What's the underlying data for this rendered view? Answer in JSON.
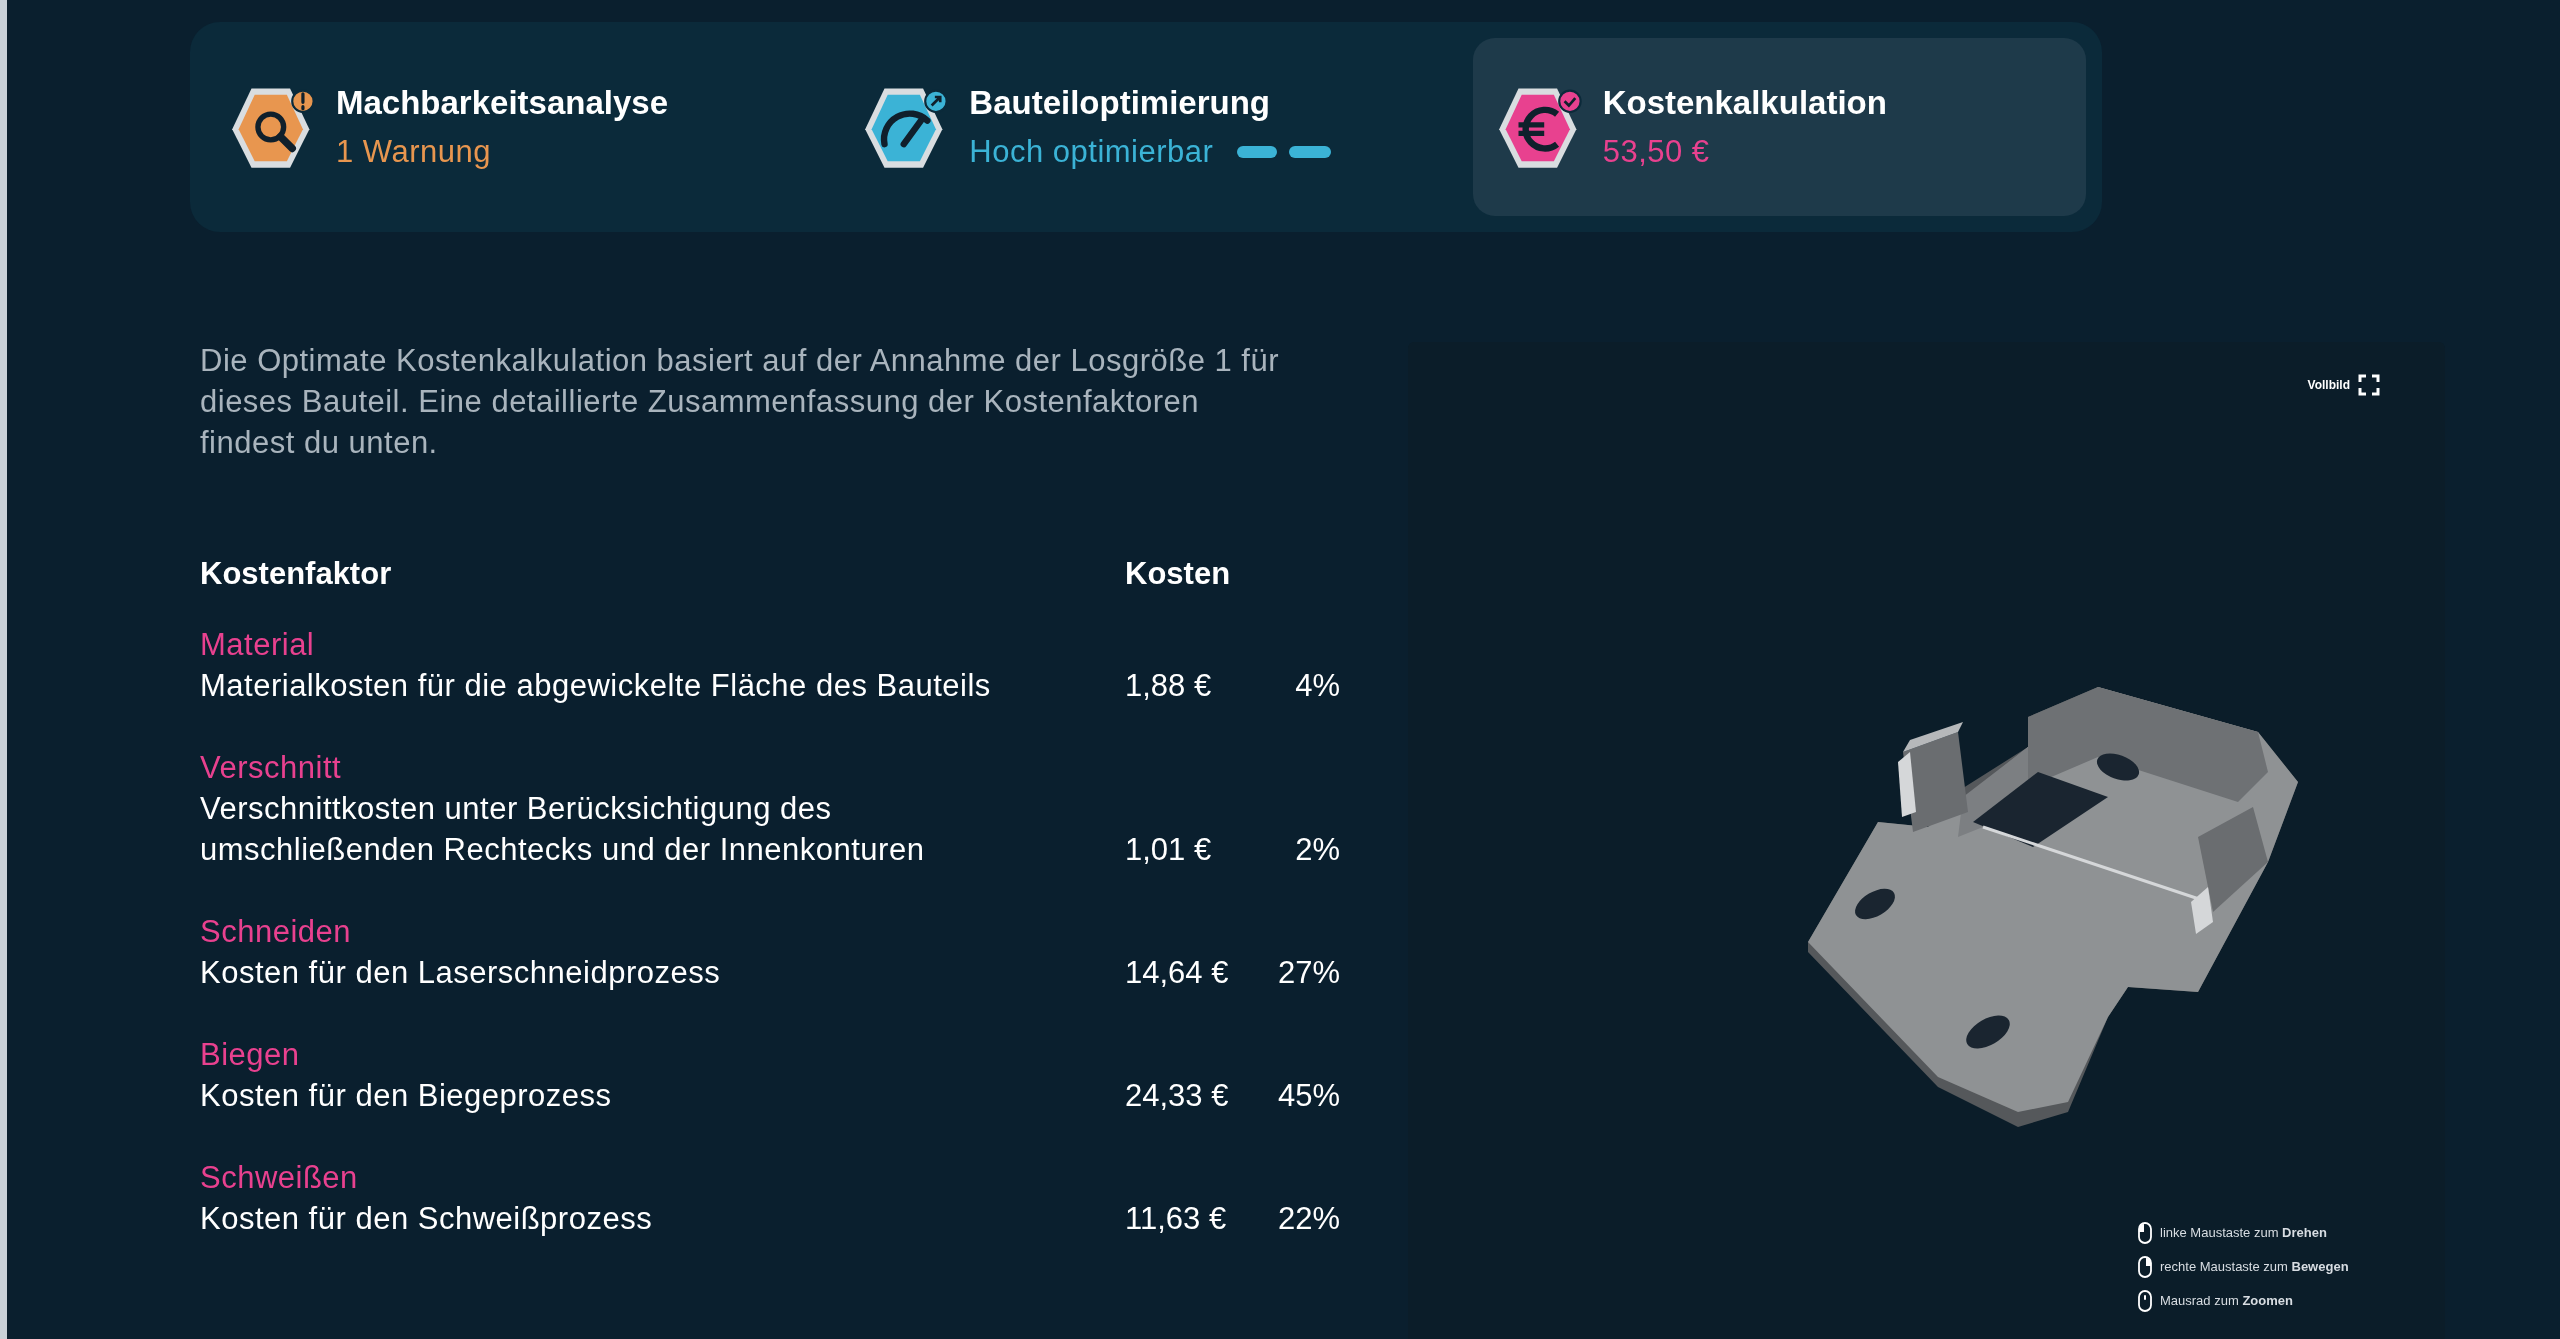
{
  "tabs": [
    {
      "kind": "feasibility",
      "title": "Machbarkeitsanalyse",
      "subtitle": "1 Warnung",
      "color": "#e8964f",
      "selected": false
    },
    {
      "kind": "optimization",
      "title": "Bauteiloptimierung",
      "subtitle": "Hoch optimierbar",
      "color": "#3bb3d6",
      "selected": false
    },
    {
      "kind": "cost",
      "title": "Kostenkalkulation",
      "subtitle": "53,50 €",
      "color": "#e8418f",
      "selected": true
    }
  ],
  "intro": "Die Optimate Kostenkalkulation basiert auf der Annahme der Losgröße 1 für dieses Bauteil. Eine detaillierte Zusammenfassung der Kostenfaktoren findest du unten.",
  "table": {
    "columns": [
      "Kostenfaktor",
      "Kosten"
    ],
    "rows": [
      {
        "name": "Material",
        "description": "Materialkosten für die abgewickelte Fläche des Bauteils",
        "cost": "1,88 €",
        "share": "4%"
      },
      {
        "name": "Verschnitt",
        "description": "Verschnittkosten unter Berücksichtigung des umschließenden Rechtecks und der Innenkonturen",
        "cost": "1,01 €",
        "share": "2%"
      },
      {
        "name": "Schneiden",
        "description": "Kosten für den Laserschneidprozess",
        "cost": "14,64 €",
        "share": "27%"
      },
      {
        "name": "Biegen",
        "description": "Kosten für den Biegeprozess",
        "cost": "24,33 €",
        "share": "45%"
      },
      {
        "name": "Schweißen",
        "description": "Kosten für den Schweißprozess",
        "cost": "11,63 €",
        "share": "22%"
      }
    ]
  },
  "viewer": {
    "fullscreen": "Vollbild",
    "hints": [
      {
        "kind": "left",
        "text": "linke Maustaste zum **Drehen**"
      },
      {
        "kind": "right",
        "text": "rechte Maustaste zum **Bewegen**"
      },
      {
        "kind": "wheel",
        "text": "Mausrad zum **Zoomen**"
      }
    ]
  }
}
